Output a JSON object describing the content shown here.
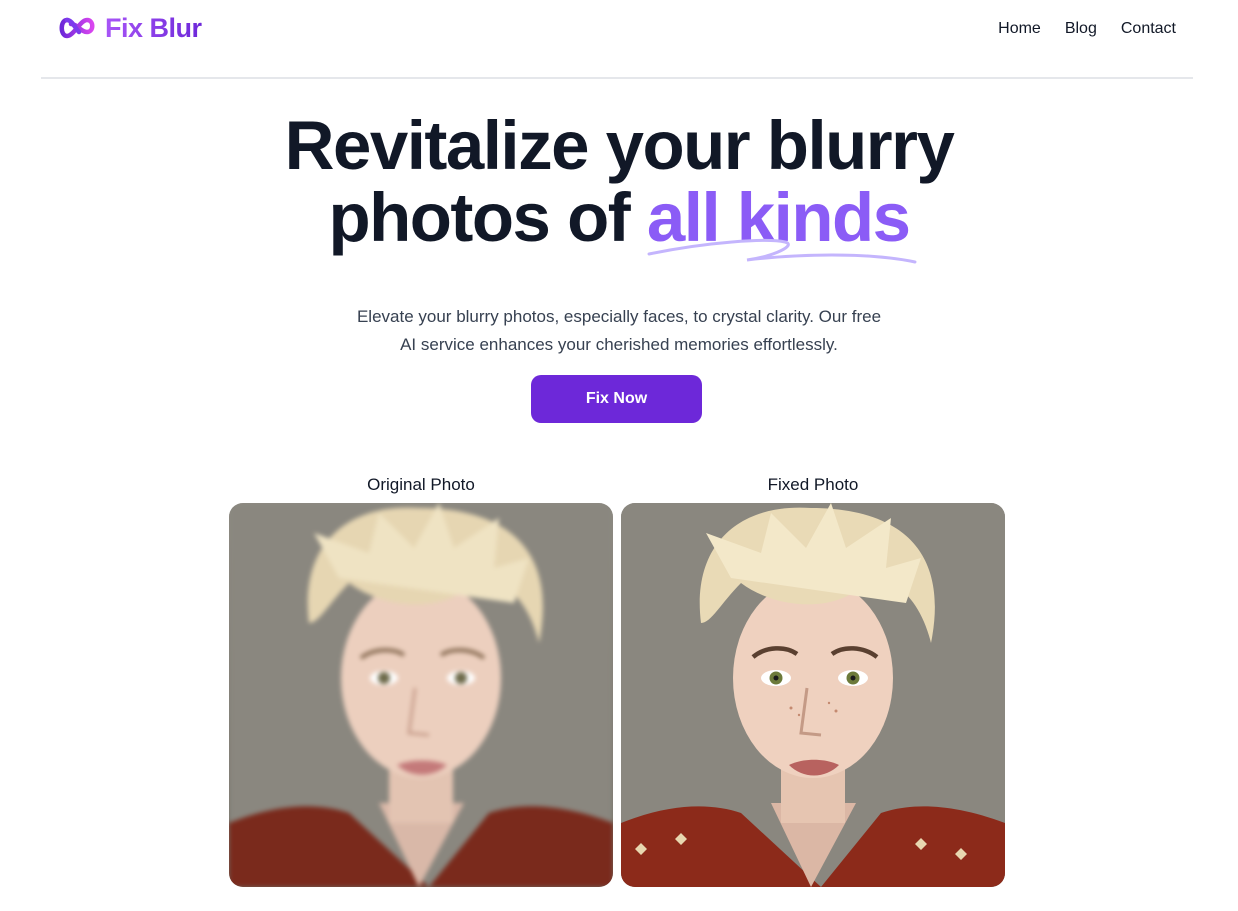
{
  "header": {
    "brand": "Fix Blur",
    "logo_icon": "infinity-icon",
    "nav": [
      {
        "label": "Home"
      },
      {
        "label": "Blog"
      },
      {
        "label": "Contact"
      }
    ]
  },
  "hero": {
    "title_line1": "Revitalize your blurry",
    "title_line2_prefix": "photos of ",
    "title_accent": "all kinds",
    "subtitle_line1": "Elevate your blurry photos, especially faces, to crystal clarity. Our free",
    "subtitle_line2": "AI service enhances your cherished memories effortlessly.",
    "cta_label": "Fix Now"
  },
  "comparison": {
    "original_label": "Original Photo",
    "fixed_label": "Fixed Photo"
  },
  "colors": {
    "brand": "#7c3aed",
    "accent": "#8b5cf6",
    "button": "#6d28d9",
    "text": "#111827"
  }
}
